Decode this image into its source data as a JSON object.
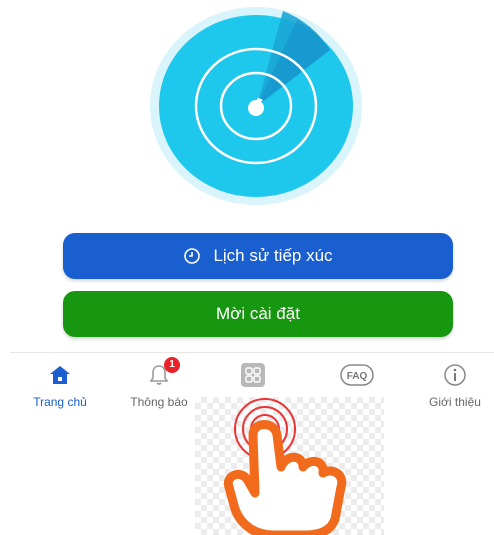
{
  "buttons": {
    "history_label": "Lịch sử tiếp xúc",
    "invite_label": "Mời cài đặt"
  },
  "nav": {
    "items": [
      {
        "label": "Trang chủ",
        "icon": "home-icon",
        "active": true
      },
      {
        "label": "Thông báo",
        "icon": "bell-icon",
        "badge": "1"
      },
      {
        "label": "",
        "icon": "grid-icon"
      },
      {
        "label": "",
        "icon": "faq-icon",
        "icon_text": "FAQ"
      },
      {
        "label": "Giới thiệu",
        "icon": "info-icon"
      }
    ]
  },
  "colors": {
    "primary_blue": "#1a5fcf",
    "green": "#17960f",
    "radar_cyan": "#1ec8ec",
    "badge_red": "#e8232a",
    "hand_orange": "#f26b1d"
  }
}
